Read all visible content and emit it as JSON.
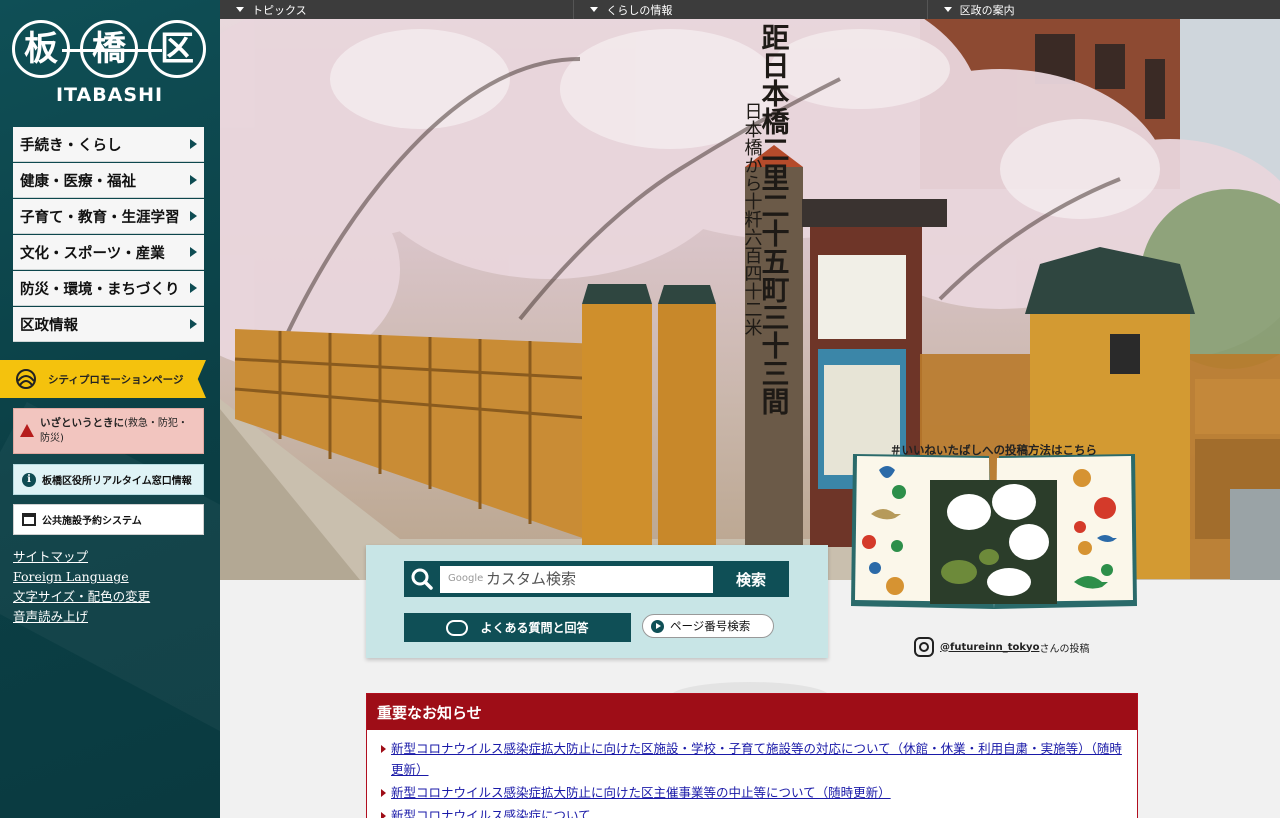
{
  "logo": {
    "kanji": [
      "板",
      "橋",
      "区"
    ],
    "roman": "ITABASHI"
  },
  "menu": [
    {
      "label": "手続き・くらし"
    },
    {
      "label": "健康・医療・福祉"
    },
    {
      "label": "子育て・教育・生涯学習"
    },
    {
      "label": "文化・スポーツ・産業"
    },
    {
      "label": "防災・環境・まちづくり"
    },
    {
      "label": "区政情報"
    }
  ],
  "promo": {
    "label": "シティプロモーションページ"
  },
  "emergency": {
    "title": "いざというときに",
    "detail": "(救急・防犯・防災)"
  },
  "realtime": {
    "label": "板橋区役所リアルタイム窓口情報"
  },
  "reserve": {
    "label": "公共施設予約システム"
  },
  "links": [
    "サイトマップ",
    "Foreign Language",
    "文字サイズ・配色の変更",
    "音声読み上げ"
  ],
  "topnav": [
    "トピックス",
    "くらしの情報",
    "区政の案内"
  ],
  "hero": {
    "signpost_text": "距日本橋二里二十五町三十三間",
    "signpost_side": "日本橋から十粁六百四十二米"
  },
  "search": {
    "google_label": "Google",
    "placeholder": "カスタム検索",
    "button": "検索",
    "faq": "よくある質問と回答",
    "page_number": "ページ番号検索"
  },
  "instagram": {
    "title": "＃いいねいたばしへの投稿方法はこちら",
    "handle": "@futureinn_tokyo",
    "suffix": "さんの投稿"
  },
  "notice": {
    "heading": "重要なお知らせ",
    "items": [
      "新型コロナウイルス感染症拡大防止に向けた区施設・学校・子育て施設等の対応について（休館・休業・利用自粛・実施等）（随時更新）",
      "新型コロナウイルス感染症拡大防止に向けた区主催事業等の中止等について（随時更新）",
      "新型コロナウイルス感染症について"
    ]
  },
  "colors": {
    "sidebar": "#0f4f56",
    "promo": "#f4c20d",
    "notice_red": "#9e0d17",
    "link_blue": "#1a1aa8"
  }
}
